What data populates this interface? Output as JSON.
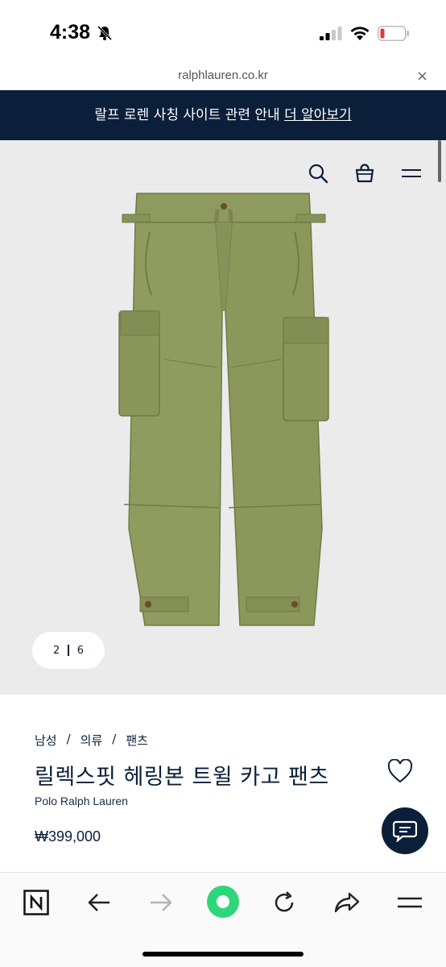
{
  "status": {
    "time": "4:38"
  },
  "url_bar": {
    "url": "ralphlauren.co.kr",
    "close_label": "×"
  },
  "banner": {
    "text": "랄프 로렌 사칭 사이트 관련 안내",
    "link": "더 알아보기"
  },
  "gallery": {
    "current": "2",
    "total": "6"
  },
  "product": {
    "breadcrumb": [
      "남성",
      "의류",
      "팬츠"
    ],
    "breadcrumb_sep": "/",
    "title": "릴렉스핏 헤링본 트윌 카고 팬츠",
    "brand": "Polo Ralph Lauren",
    "price": "₩399,000"
  },
  "colors": {
    "navy": "#0b1f3a",
    "accent_green": "#2ed67a",
    "pants_olive": "#8e9a5c"
  },
  "icons": [
    "bell-slash-icon",
    "signal-icon",
    "wifi-icon",
    "battery-icon",
    "search-icon",
    "shopping-bag-icon",
    "menu-icon",
    "heart-icon",
    "chat-icon",
    "n-logo-icon",
    "back-arrow-icon",
    "forward-arrow-icon",
    "home-dot-icon",
    "refresh-icon",
    "share-icon",
    "more-menu-icon"
  ]
}
